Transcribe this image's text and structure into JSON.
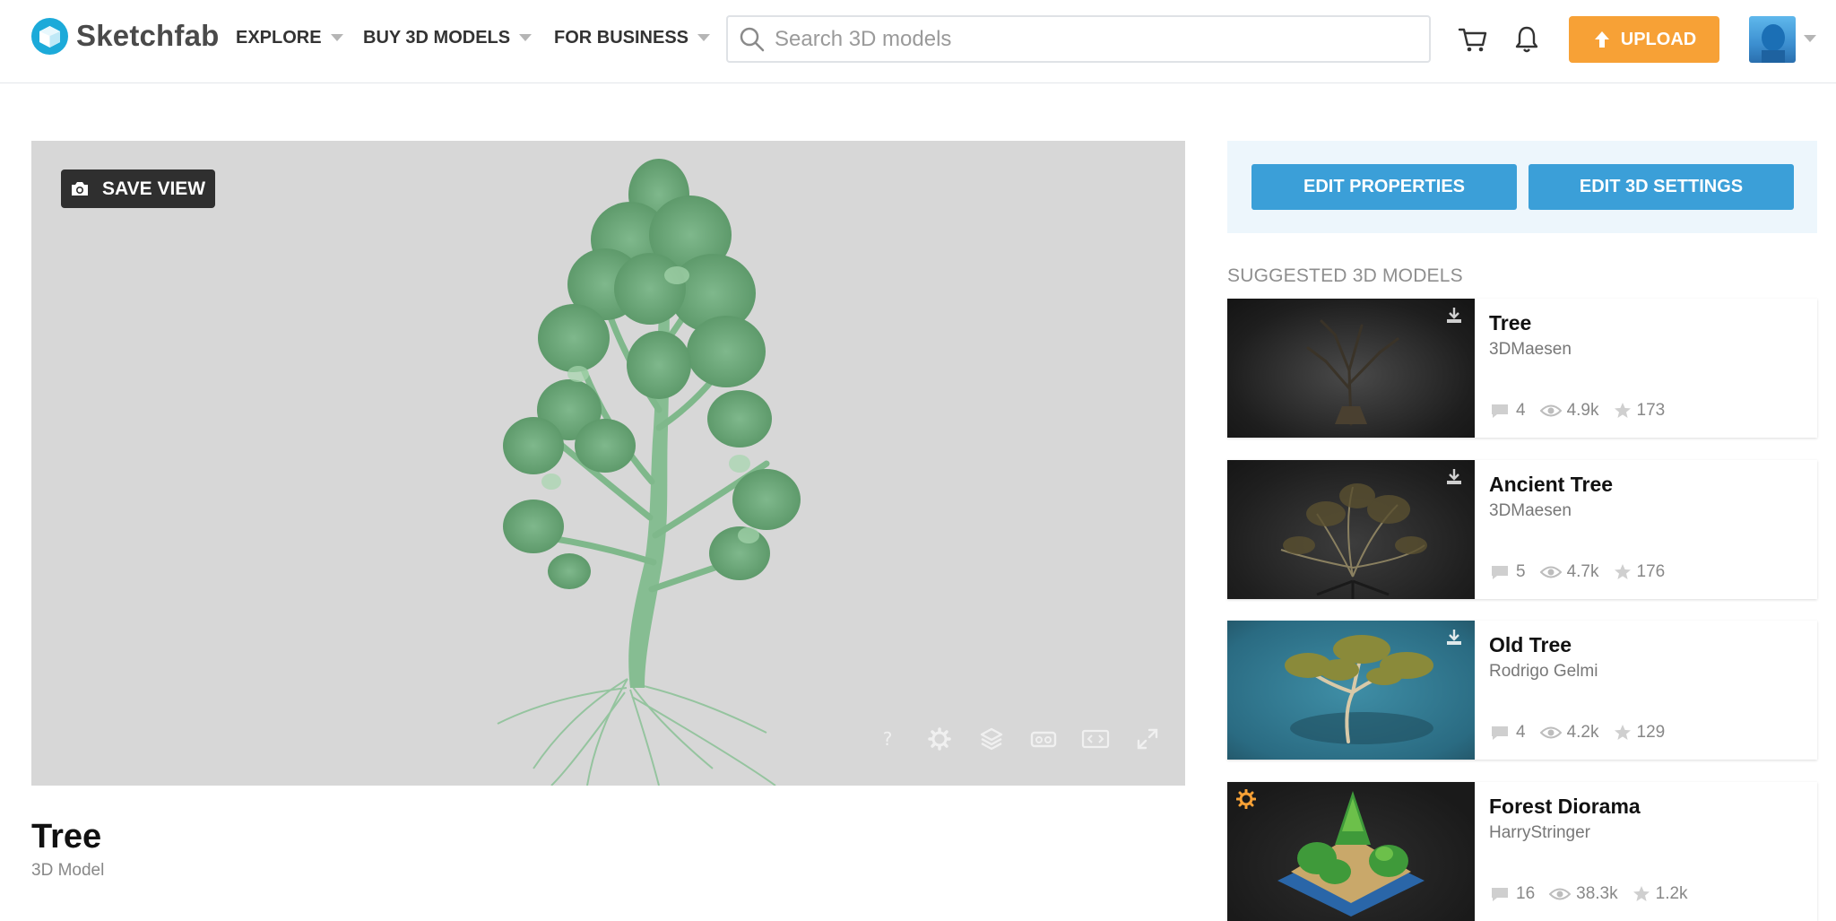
{
  "app": {
    "name": "Sketchfab"
  },
  "nav": {
    "explore": "EXPLORE",
    "buy": "BUY 3D MODELS",
    "business": "FOR BUSINESS"
  },
  "search": {
    "placeholder": "Search 3D models"
  },
  "header": {
    "upload_label": "UPLOAD"
  },
  "viewer": {
    "save_view_label": "SAVE VIEW"
  },
  "model": {
    "title": "Tree",
    "type": "3D Model"
  },
  "actions": {
    "edit_properties": "EDIT PROPERTIES",
    "edit_3d_settings": "EDIT 3D SETTINGS"
  },
  "suggested": {
    "heading": "SUGGESTED 3D MODELS",
    "items": [
      {
        "name": "Tree",
        "author": "3DMaesen",
        "comments": "4",
        "views": "4.9k",
        "likes": "173"
      },
      {
        "name": "Ancient Tree",
        "author": "3DMaesen",
        "comments": "5",
        "views": "4.7k",
        "likes": "176"
      },
      {
        "name": "Old Tree",
        "author": "Rodrigo Gelmi",
        "comments": "4",
        "views": "4.2k",
        "likes": "129"
      },
      {
        "name": "Forest Diorama",
        "author": "HarryStringer",
        "comments": "16",
        "views": "38.3k",
        "likes": "1.2k"
      }
    ]
  },
  "colors": {
    "accent": "#1caad9",
    "upload": "#f7a136",
    "edit_button": "#3b9fd8",
    "staff_pick": "#f7a136"
  }
}
